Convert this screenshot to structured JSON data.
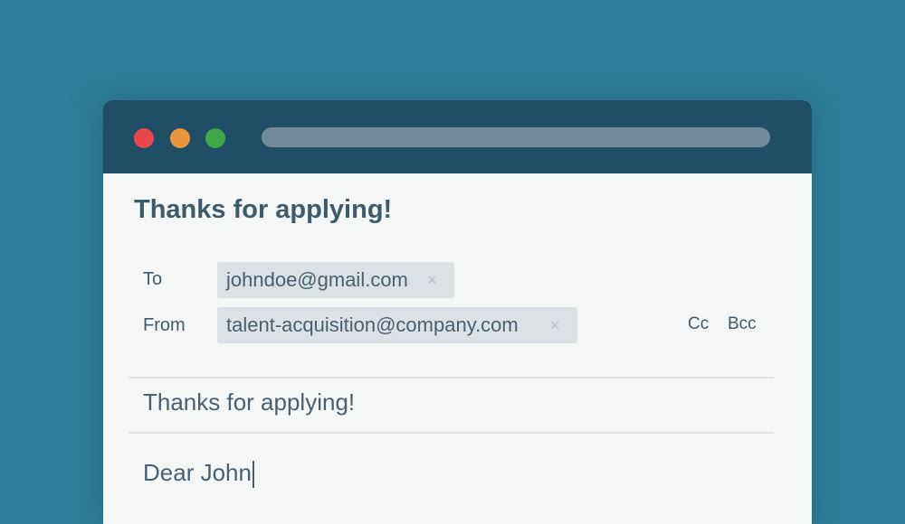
{
  "window": {
    "controls": [
      "close",
      "minimize",
      "maximize"
    ]
  },
  "email": {
    "heading": "Thanks for applying!",
    "to_label": "To",
    "to_value": "johndoe@gmail.com",
    "from_label": "From",
    "from_value": "talent-acquisition@company.com",
    "cc_label": "Cc",
    "bcc_label": "Bcc",
    "subject": "Thanks for applying!",
    "body": "Dear John"
  },
  "icons": {
    "remove": "×"
  },
  "colors": {
    "background": "#2e7f9b",
    "titlebar": "#1f4e66",
    "close": "#e8474c",
    "minimize": "#e9953e",
    "maximize": "#3fa64a",
    "chip": "#dbe1e4",
    "text": "#3f5a69"
  }
}
